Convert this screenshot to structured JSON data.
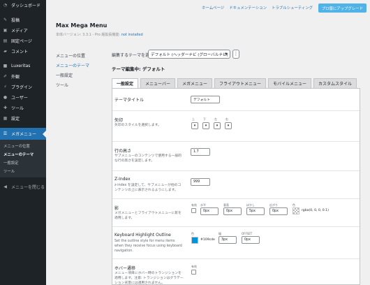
{
  "sidebar": {
    "items": [
      {
        "label": "ダッシュボード",
        "icon": "dashboard-icon"
      },
      {
        "label": "投稿",
        "icon": "pin-icon"
      },
      {
        "label": "メディア",
        "icon": "media-icon"
      },
      {
        "label": "固定ページ",
        "icon": "page-icon"
      },
      {
        "label": "コメント",
        "icon": "comment-icon"
      },
      {
        "label": "Luxeritas",
        "icon": "luxeritas-icon"
      },
      {
        "label": "外観",
        "icon": "brush-icon"
      },
      {
        "label": "プラグイン",
        "icon": "plugin-icon"
      },
      {
        "label": "ユーザー",
        "icon": "user-icon"
      },
      {
        "label": "ツール",
        "icon": "wrench-icon"
      },
      {
        "label": "設定",
        "icon": "settings-icon"
      }
    ],
    "current": {
      "label": "メガメニュー",
      "icon": "megamenu-icon"
    },
    "submenu": [
      "メニューの位置",
      "メニューのテーマ",
      "一般設定",
      "ツール"
    ],
    "collapse_label": "メニューを閉じる"
  },
  "topbar": {
    "links": [
      "ホームページ",
      "ドキュメンテーション",
      "トラブルシューティング"
    ],
    "upgrade_label": "プロ版にアップグレード"
  },
  "plugin": {
    "title": "Max Mega Menu",
    "version_text": "本体バージョン: 3.3.1 - Pro 版拡張機能: ",
    "license_text": "not installed"
  },
  "plugin_nav": [
    "メニューの位置",
    "メニューのテーマ",
    "一般設定",
    "ツール"
  ],
  "theme_select": {
    "label": "編集するテーマを選択",
    "value": "デフォルト (ヘッダーナビ (グローバルナビ) )"
  },
  "editing_heading": "テーマ編集中: デフォルト",
  "tabs": [
    "一般設定",
    "メニューバー",
    "メガメニュー",
    "フライアウトメニュー",
    "モバイルメニュー",
    "カスタムスタイル"
  ],
  "settings": {
    "theme_title": {
      "label": "テーマタイトル",
      "value": "デフォルト"
    },
    "arrow": {
      "label": "矢印",
      "desc": "矢印のスタイルを選択します。",
      "directions": [
        "上",
        "下",
        "左",
        "右"
      ],
      "values": [
        "▾",
        "▾",
        "▾",
        "▾"
      ]
    },
    "line_height": {
      "label": "行の高さ",
      "desc": "サブメニューのコンテンツで使用する一般的な行の高さを設定します。",
      "value": "1.7"
    },
    "z_index": {
      "label": "Z-Index",
      "desc": "z-index を設定して、サブメニューが他のコンテンツの上に表示されるようにします。",
      "value": "999"
    },
    "shadow": {
      "label": "影",
      "desc": "メガメニューとフライアウトメニューに影を適用します。",
      "fields": [
        {
          "label": "有効",
          "value": ""
        },
        {
          "label": "水平",
          "value": "0px"
        },
        {
          "label": "垂直",
          "value": "0px"
        },
        {
          "label": "ぼかし",
          "value": "5px"
        },
        {
          "label": "広がり",
          "value": "0px"
        },
        {
          "label": "色",
          "value": "rgba(0, 0, 0, 0.1)"
        }
      ]
    },
    "highlight_outline": {
      "label": "Keyboard Highlight Outline",
      "desc": "Set the outline style for menu items when they receive focus using keyboard navigation.",
      "color_label": "色",
      "color_value": "#109cde",
      "width_label": "幅",
      "width_value": "3px",
      "offset_label": "OFFSET",
      "offset_value": "0px"
    },
    "hover_transition": {
      "label": "ホバー遷移",
      "desc": "メニュー項目にホバー時のトランジションを適用します。注意: トランジションはグラデーション背景には適用されません。",
      "enabled_label": "有効"
    }
  },
  "colors": {
    "accent": "#2271b1",
    "sidebar_bg": "#1d2327",
    "highlight": "#109cde"
  }
}
